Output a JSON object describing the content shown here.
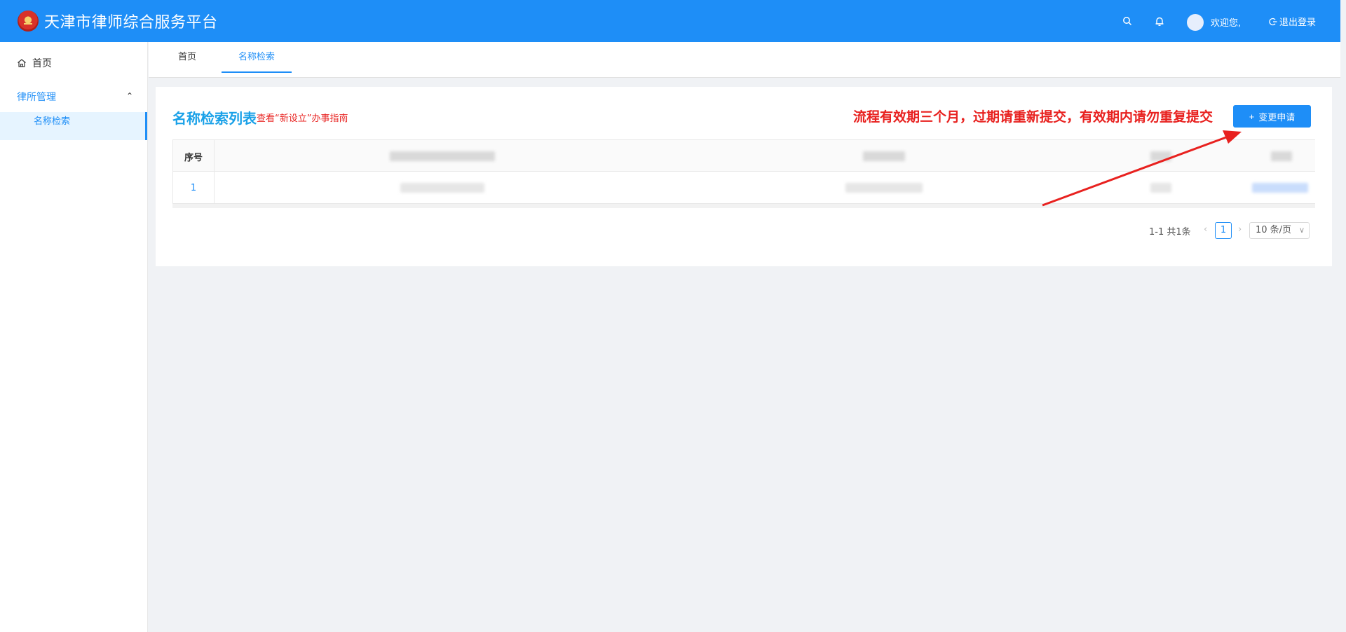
{
  "header": {
    "title": "天津市律师综合服务平台",
    "welcome": "欢迎您,",
    "logout": "退出登录",
    "icons": [
      "search-icon",
      "bell-icon",
      "logout-icon"
    ],
    "color": "#1e8ef7"
  },
  "sidebar": {
    "home": "首页",
    "group": "律所管理",
    "sub_item": "名称检索"
  },
  "tabs": [
    {
      "label": "首页"
    },
    {
      "label": "名称检索"
    }
  ],
  "card": {
    "title": "名称检索列表",
    "guide_link": "查看“新设立”办事指南",
    "notice": "流程有效期三个月，过期请重新提交，有效期内请勿重复提交",
    "change_button": "变更申请"
  },
  "table": {
    "header_index": "序号",
    "rows": [
      {
        "index": "1"
      }
    ]
  },
  "pagination": {
    "total": "1-1 共1条",
    "current_page": "1",
    "page_size": "10 条/页"
  }
}
